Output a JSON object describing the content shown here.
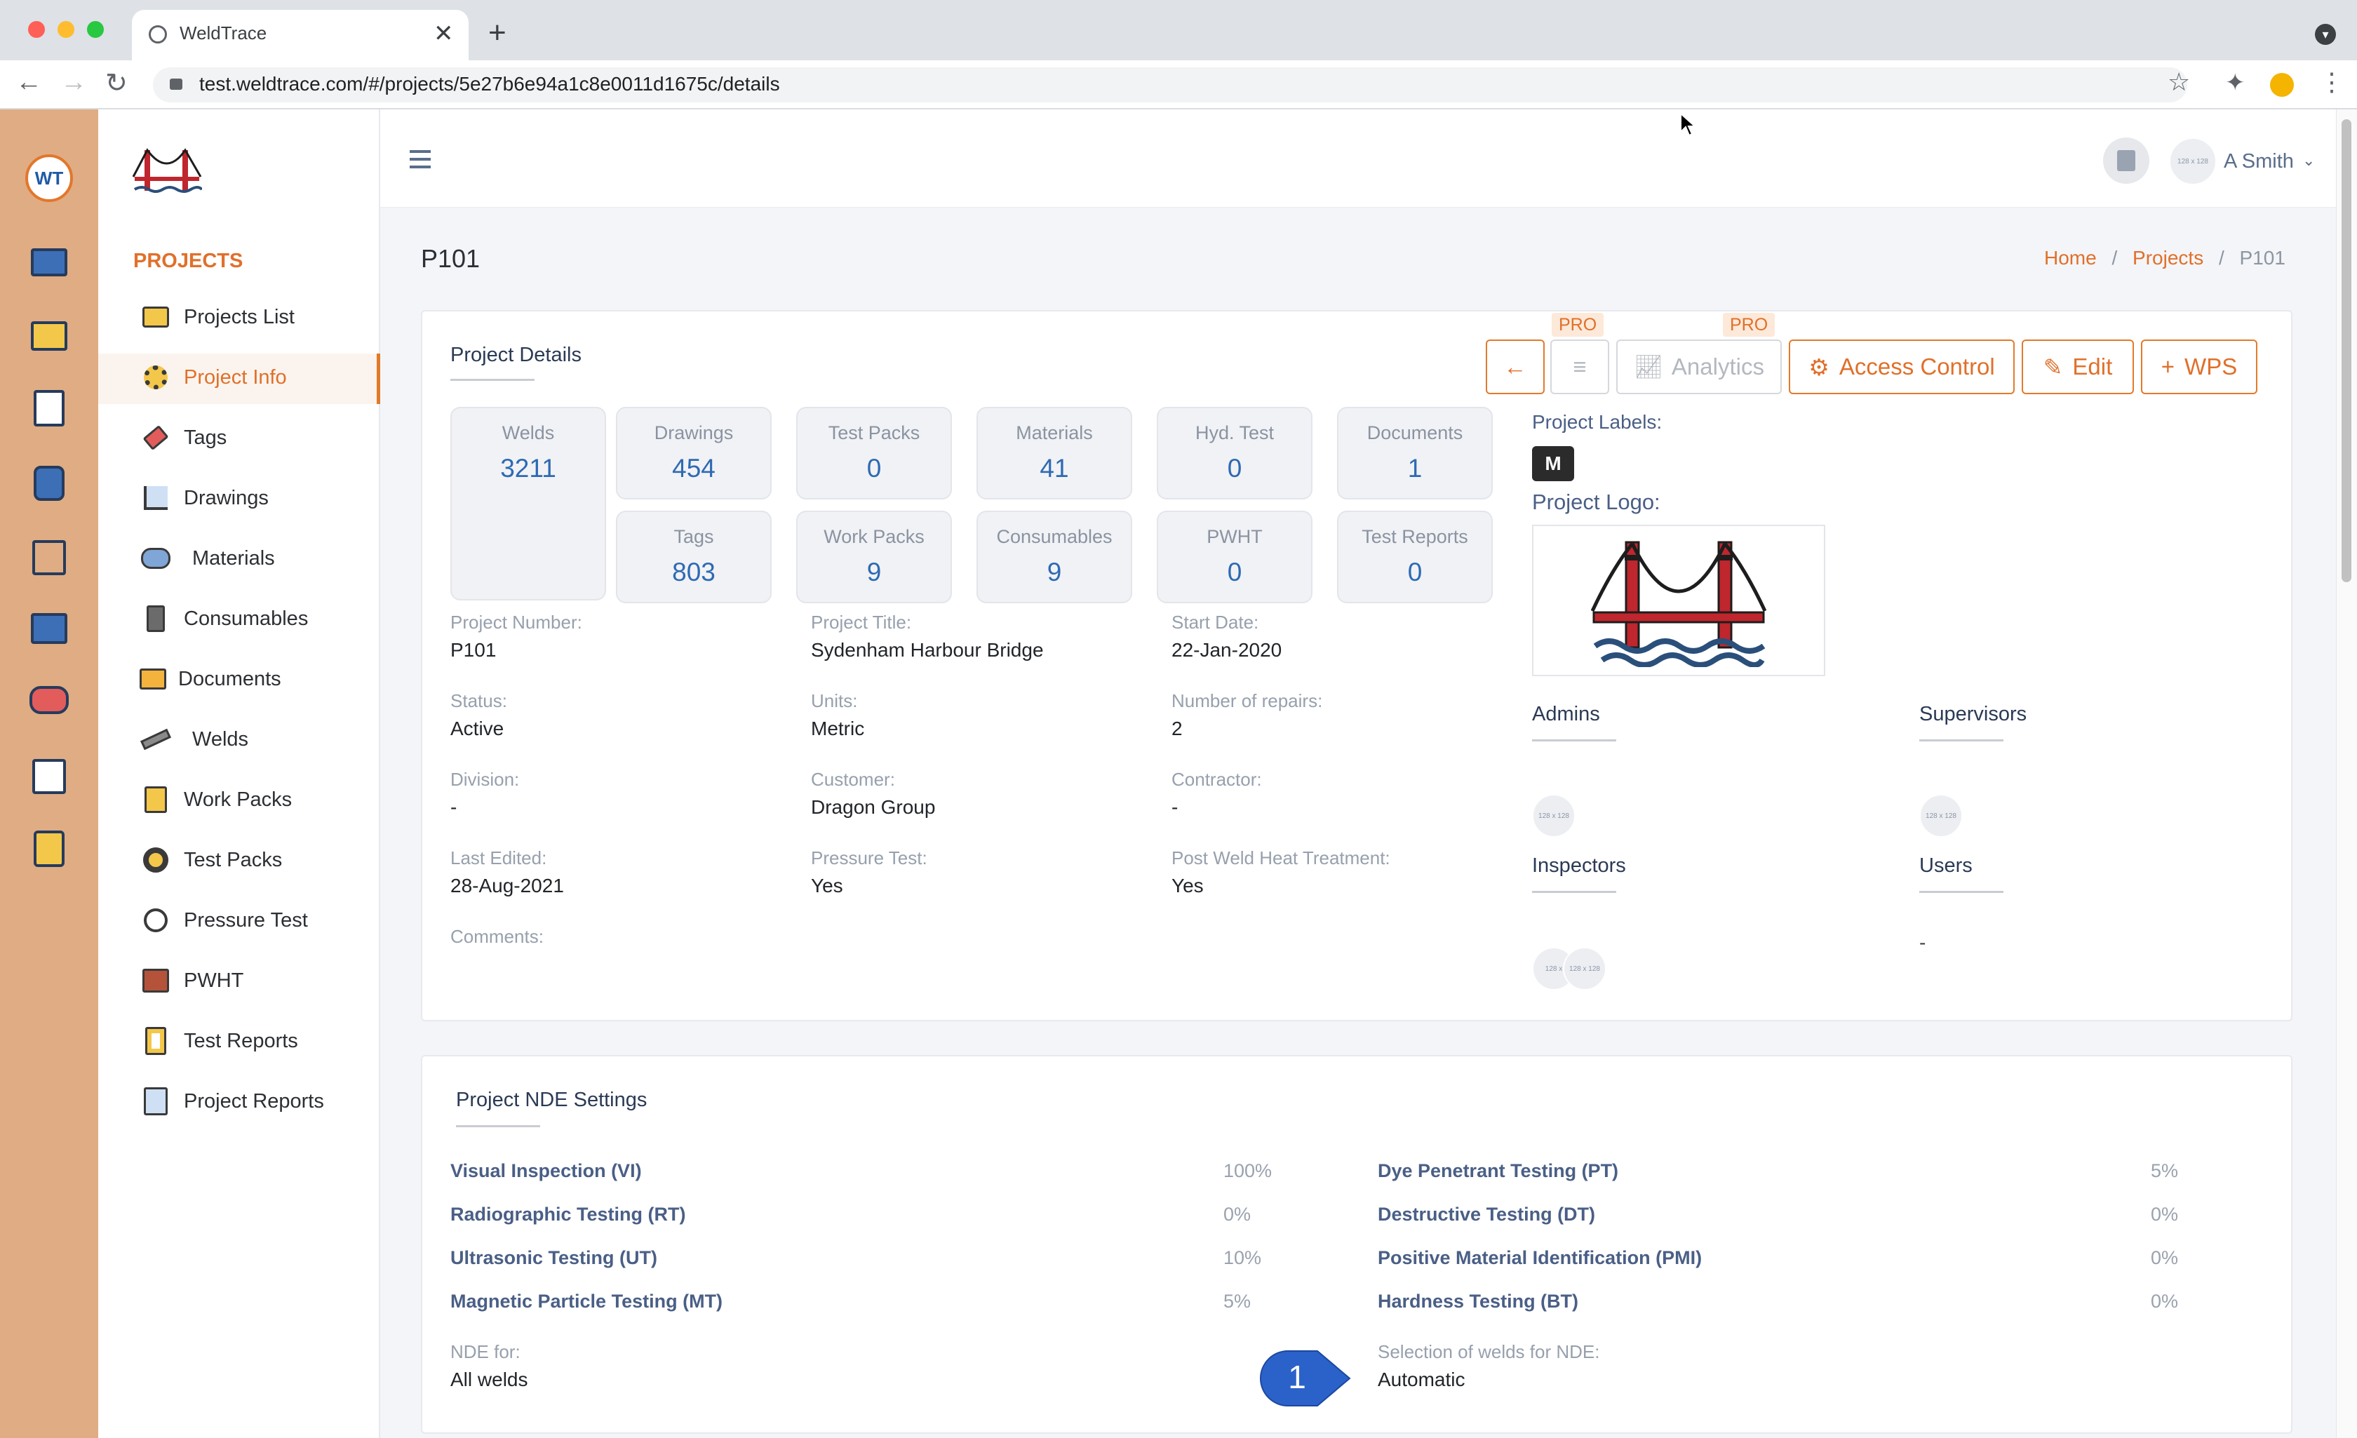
{
  "browser": {
    "tab_title": "WeldTrace",
    "url": "test.weldtrace.com/#/projects/5e27b6e94a1c8e0011d1675c/details"
  },
  "sidebar": {
    "section_title": "PROJECTS",
    "items": [
      {
        "label": "Projects List",
        "icon": "camera-folder-icon"
      },
      {
        "label": "Project Info",
        "icon": "gears-icon",
        "active": true
      },
      {
        "label": "Tags",
        "icon": "tag-icon"
      },
      {
        "label": "Drawings",
        "icon": "compass-drawing-icon"
      },
      {
        "label": "Materials",
        "icon": "pipes-stack-icon"
      },
      {
        "label": "Consumables",
        "icon": "spool-icon"
      },
      {
        "label": "Documents",
        "icon": "folder-icon"
      },
      {
        "label": "Welds",
        "icon": "welding-torch-icon"
      },
      {
        "label": "Work Packs",
        "icon": "clipboard-icon"
      },
      {
        "label": "Test Packs",
        "icon": "radiation-icon"
      },
      {
        "label": "Pressure Test",
        "icon": "pressure-gauge-icon"
      },
      {
        "label": "PWHT",
        "icon": "heater-icon"
      },
      {
        "label": "Test Reports",
        "icon": "report-list-icon"
      },
      {
        "label": "Project Reports",
        "icon": "report-chart-icon"
      }
    ]
  },
  "topbar": {
    "user_name": "A Smith",
    "avatar_text": "128 x 128"
  },
  "page": {
    "title": "P101",
    "breadcrumb": [
      "Home",
      "Projects",
      "P101"
    ]
  },
  "details": {
    "card_title": "Project Details",
    "buttons": {
      "analytics": "Analytics",
      "access_control": "Access Control",
      "edit": "Edit",
      "wps": "WPS",
      "pro_badge": "PRO"
    },
    "stats": {
      "welds": {
        "label": "Welds",
        "value": "3211"
      },
      "drawings": {
        "label": "Drawings",
        "value": "454"
      },
      "test_packs": {
        "label": "Test Packs",
        "value": "0"
      },
      "materials": {
        "label": "Materials",
        "value": "41"
      },
      "hyd_test": {
        "label": "Hyd. Test",
        "value": "0"
      },
      "documents": {
        "label": "Documents",
        "value": "1"
      },
      "tags": {
        "label": "Tags",
        "value": "803"
      },
      "work_packs": {
        "label": "Work Packs",
        "value": "9"
      },
      "consumables": {
        "label": "Consumables",
        "value": "9"
      },
      "pwht": {
        "label": "PWHT",
        "value": "0"
      },
      "test_reports": {
        "label": "Test Reports",
        "value": "0"
      }
    },
    "fields": {
      "project_number": {
        "label": "Project Number:",
        "value": "P101"
      },
      "project_title": {
        "label": "Project Title:",
        "value": "Sydenham Harbour Bridge"
      },
      "start_date": {
        "label": "Start Date:",
        "value": "22-Jan-2020"
      },
      "status": {
        "label": "Status:",
        "value": "Active"
      },
      "units": {
        "label": "Units:",
        "value": "Metric"
      },
      "repairs": {
        "label": "Number of repairs:",
        "value": "2"
      },
      "division": {
        "label": "Division:",
        "value": "-"
      },
      "customer": {
        "label": "Customer:",
        "value": "Dragon Group"
      },
      "contractor": {
        "label": "Contractor:",
        "value": "-"
      },
      "last_edited": {
        "label": "Last Edited:",
        "value": "28-Aug-2021"
      },
      "pressure_test": {
        "label": "Pressure Test:",
        "value": "Yes"
      },
      "pwht": {
        "label": "Post Weld Heat Treatment:",
        "value": "Yes"
      },
      "comments": {
        "label": "Comments:",
        "value": ""
      }
    },
    "labels_title": "Project Labels:",
    "label_badge": "M",
    "logo_title": "Project Logo:",
    "roles": {
      "admins": "Admins",
      "supervisors": "Supervisors",
      "inspectors": "Inspectors",
      "users": "Users",
      "users_value": "-",
      "avatar_text": "128 x 128",
      "avatar_text_short": "128 x"
    }
  },
  "nde": {
    "card_title": "Project NDE Settings",
    "left": [
      {
        "label": "Visual Inspection (VI)",
        "value": "100%"
      },
      {
        "label": "Radiographic Testing (RT)",
        "value": "0%"
      },
      {
        "label": "Ultrasonic Testing (UT)",
        "value": "10%"
      },
      {
        "label": "Magnetic Particle Testing (MT)",
        "value": "5%"
      }
    ],
    "right": [
      {
        "label": "Dye Penetrant Testing (PT)",
        "value": "5%"
      },
      {
        "label": "Destructive Testing (DT)",
        "value": "0%"
      },
      {
        "label": "Positive Material Identification (PMI)",
        "value": "0%"
      },
      {
        "label": "Hardness Testing (BT)",
        "value": "0%"
      }
    ],
    "nde_for": {
      "label": "NDE for:",
      "value": "All welds"
    },
    "selection": {
      "label": "Selection of welds for NDE:",
      "value": "Automatic"
    },
    "callout": "1"
  },
  "colors": {
    "accent": "#e0702a",
    "rail": "#e0ac83",
    "stat_value": "#2e6ab3",
    "callout": "#2b62c9"
  }
}
